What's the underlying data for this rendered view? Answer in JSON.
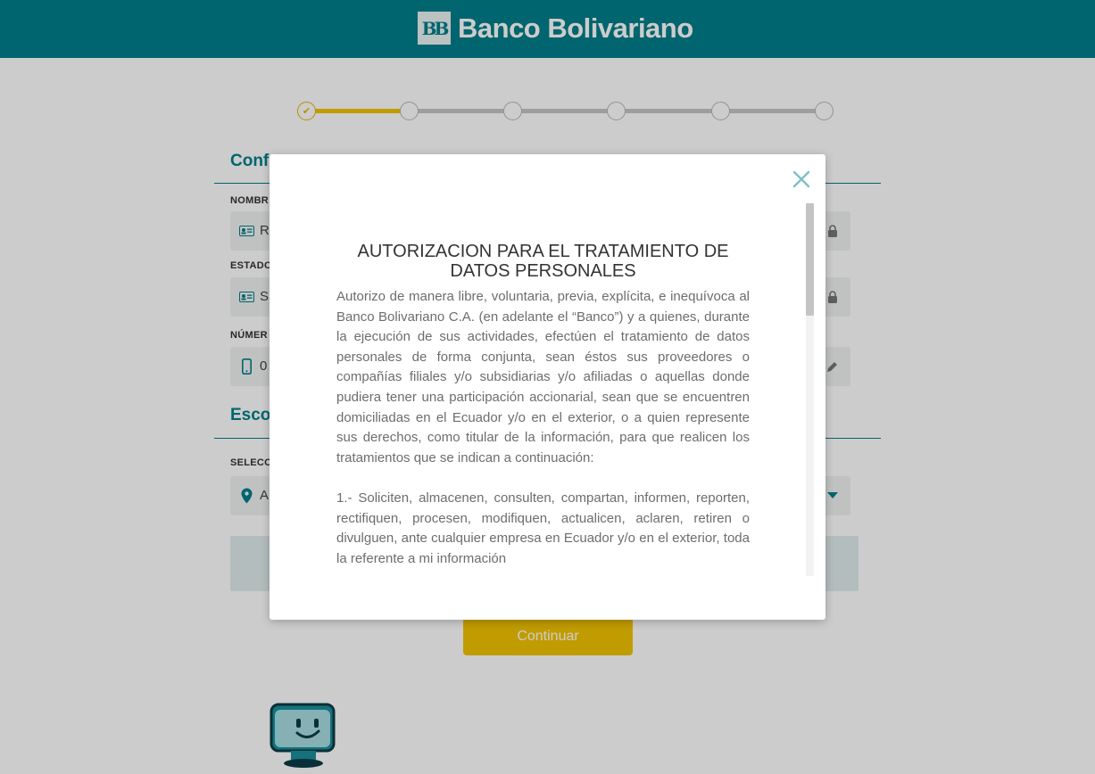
{
  "header": {
    "logo_mark": "BB",
    "brand": "Banco Bolivariano"
  },
  "stepper": {
    "total_steps": 6,
    "completed_steps": 1,
    "check": "✔"
  },
  "form": {
    "section1_title": "Conf",
    "name_label": "NOMBR",
    "name_value": "R",
    "civil_label": "ESTADO",
    "civil_value": "S",
    "phone_label": "NÚMER",
    "phone_value": "0",
    "section2_title": "Esco",
    "select_label": "SELECC",
    "select_value": "A"
  },
  "continue_label": "Continuar",
  "modal": {
    "title": "AUTORIZACION PARA EL TRATAMIENTO DE DATOS PERSONALES",
    "paragraph1": "Autorizo de manera libre, voluntaria, previa, explícita, e inequívoca al Banco Bolivariano C.A. (en adelante el “Banco”) y a quienes, durante la ejecución de sus actividades, efectúen el tratamiento de datos personales de forma conjunta, sean éstos sus proveedores o compañías filiales y/o subsidiarias y/o afiliadas o aquellas donde pudiera tener una participación accionarial, sean que se encuentren domiciliadas en el Ecuador y/o en el exterior, o a quien represente sus derechos, como titular de la información, para que realicen los tratamientos que se indican a continuación:",
    "paragraph2": "1.- Soliciten, almacenen, consulten, compartan, informen, reporten, rectifiquen, procesen, modifiquen, actualicen, aclaren, retiren o divulguen, ante cualquier empresa en Ecuador y/o en el exterior, toda la referente a mi información"
  },
  "colors": {
    "brand_teal": "#007f8a",
    "accent_yellow": "#f2c300"
  }
}
